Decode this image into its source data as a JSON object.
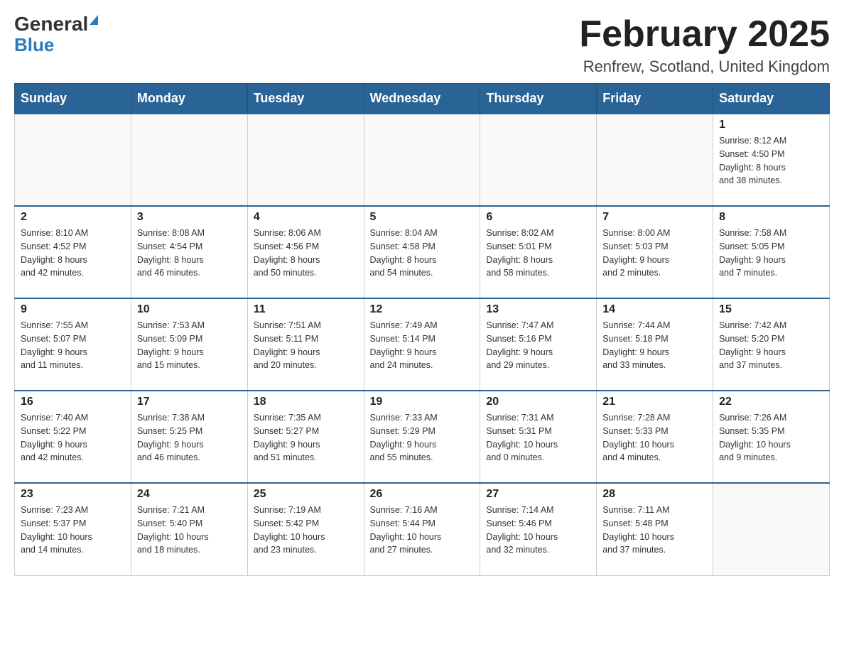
{
  "header": {
    "logo_general": "General",
    "logo_blue": "Blue",
    "month_title": "February 2025",
    "location": "Renfrew, Scotland, United Kingdom"
  },
  "days_of_week": [
    "Sunday",
    "Monday",
    "Tuesday",
    "Wednesday",
    "Thursday",
    "Friday",
    "Saturday"
  ],
  "weeks": [
    [
      {
        "day": "",
        "info": ""
      },
      {
        "day": "",
        "info": ""
      },
      {
        "day": "",
        "info": ""
      },
      {
        "day": "",
        "info": ""
      },
      {
        "day": "",
        "info": ""
      },
      {
        "day": "",
        "info": ""
      },
      {
        "day": "1",
        "info": "Sunrise: 8:12 AM\nSunset: 4:50 PM\nDaylight: 8 hours\nand 38 minutes."
      }
    ],
    [
      {
        "day": "2",
        "info": "Sunrise: 8:10 AM\nSunset: 4:52 PM\nDaylight: 8 hours\nand 42 minutes."
      },
      {
        "day": "3",
        "info": "Sunrise: 8:08 AM\nSunset: 4:54 PM\nDaylight: 8 hours\nand 46 minutes."
      },
      {
        "day": "4",
        "info": "Sunrise: 8:06 AM\nSunset: 4:56 PM\nDaylight: 8 hours\nand 50 minutes."
      },
      {
        "day": "5",
        "info": "Sunrise: 8:04 AM\nSunset: 4:58 PM\nDaylight: 8 hours\nand 54 minutes."
      },
      {
        "day": "6",
        "info": "Sunrise: 8:02 AM\nSunset: 5:01 PM\nDaylight: 8 hours\nand 58 minutes."
      },
      {
        "day": "7",
        "info": "Sunrise: 8:00 AM\nSunset: 5:03 PM\nDaylight: 9 hours\nand 2 minutes."
      },
      {
        "day": "8",
        "info": "Sunrise: 7:58 AM\nSunset: 5:05 PM\nDaylight: 9 hours\nand 7 minutes."
      }
    ],
    [
      {
        "day": "9",
        "info": "Sunrise: 7:55 AM\nSunset: 5:07 PM\nDaylight: 9 hours\nand 11 minutes."
      },
      {
        "day": "10",
        "info": "Sunrise: 7:53 AM\nSunset: 5:09 PM\nDaylight: 9 hours\nand 15 minutes."
      },
      {
        "day": "11",
        "info": "Sunrise: 7:51 AM\nSunset: 5:11 PM\nDaylight: 9 hours\nand 20 minutes."
      },
      {
        "day": "12",
        "info": "Sunrise: 7:49 AM\nSunset: 5:14 PM\nDaylight: 9 hours\nand 24 minutes."
      },
      {
        "day": "13",
        "info": "Sunrise: 7:47 AM\nSunset: 5:16 PM\nDaylight: 9 hours\nand 29 minutes."
      },
      {
        "day": "14",
        "info": "Sunrise: 7:44 AM\nSunset: 5:18 PM\nDaylight: 9 hours\nand 33 minutes."
      },
      {
        "day": "15",
        "info": "Sunrise: 7:42 AM\nSunset: 5:20 PM\nDaylight: 9 hours\nand 37 minutes."
      }
    ],
    [
      {
        "day": "16",
        "info": "Sunrise: 7:40 AM\nSunset: 5:22 PM\nDaylight: 9 hours\nand 42 minutes."
      },
      {
        "day": "17",
        "info": "Sunrise: 7:38 AM\nSunset: 5:25 PM\nDaylight: 9 hours\nand 46 minutes."
      },
      {
        "day": "18",
        "info": "Sunrise: 7:35 AM\nSunset: 5:27 PM\nDaylight: 9 hours\nand 51 minutes."
      },
      {
        "day": "19",
        "info": "Sunrise: 7:33 AM\nSunset: 5:29 PM\nDaylight: 9 hours\nand 55 minutes."
      },
      {
        "day": "20",
        "info": "Sunrise: 7:31 AM\nSunset: 5:31 PM\nDaylight: 10 hours\nand 0 minutes."
      },
      {
        "day": "21",
        "info": "Sunrise: 7:28 AM\nSunset: 5:33 PM\nDaylight: 10 hours\nand 4 minutes."
      },
      {
        "day": "22",
        "info": "Sunrise: 7:26 AM\nSunset: 5:35 PM\nDaylight: 10 hours\nand 9 minutes."
      }
    ],
    [
      {
        "day": "23",
        "info": "Sunrise: 7:23 AM\nSunset: 5:37 PM\nDaylight: 10 hours\nand 14 minutes."
      },
      {
        "day": "24",
        "info": "Sunrise: 7:21 AM\nSunset: 5:40 PM\nDaylight: 10 hours\nand 18 minutes."
      },
      {
        "day": "25",
        "info": "Sunrise: 7:19 AM\nSunset: 5:42 PM\nDaylight: 10 hours\nand 23 minutes."
      },
      {
        "day": "26",
        "info": "Sunrise: 7:16 AM\nSunset: 5:44 PM\nDaylight: 10 hours\nand 27 minutes."
      },
      {
        "day": "27",
        "info": "Sunrise: 7:14 AM\nSunset: 5:46 PM\nDaylight: 10 hours\nand 32 minutes."
      },
      {
        "day": "28",
        "info": "Sunrise: 7:11 AM\nSunset: 5:48 PM\nDaylight: 10 hours\nand 37 minutes."
      },
      {
        "day": "",
        "info": ""
      }
    ]
  ]
}
